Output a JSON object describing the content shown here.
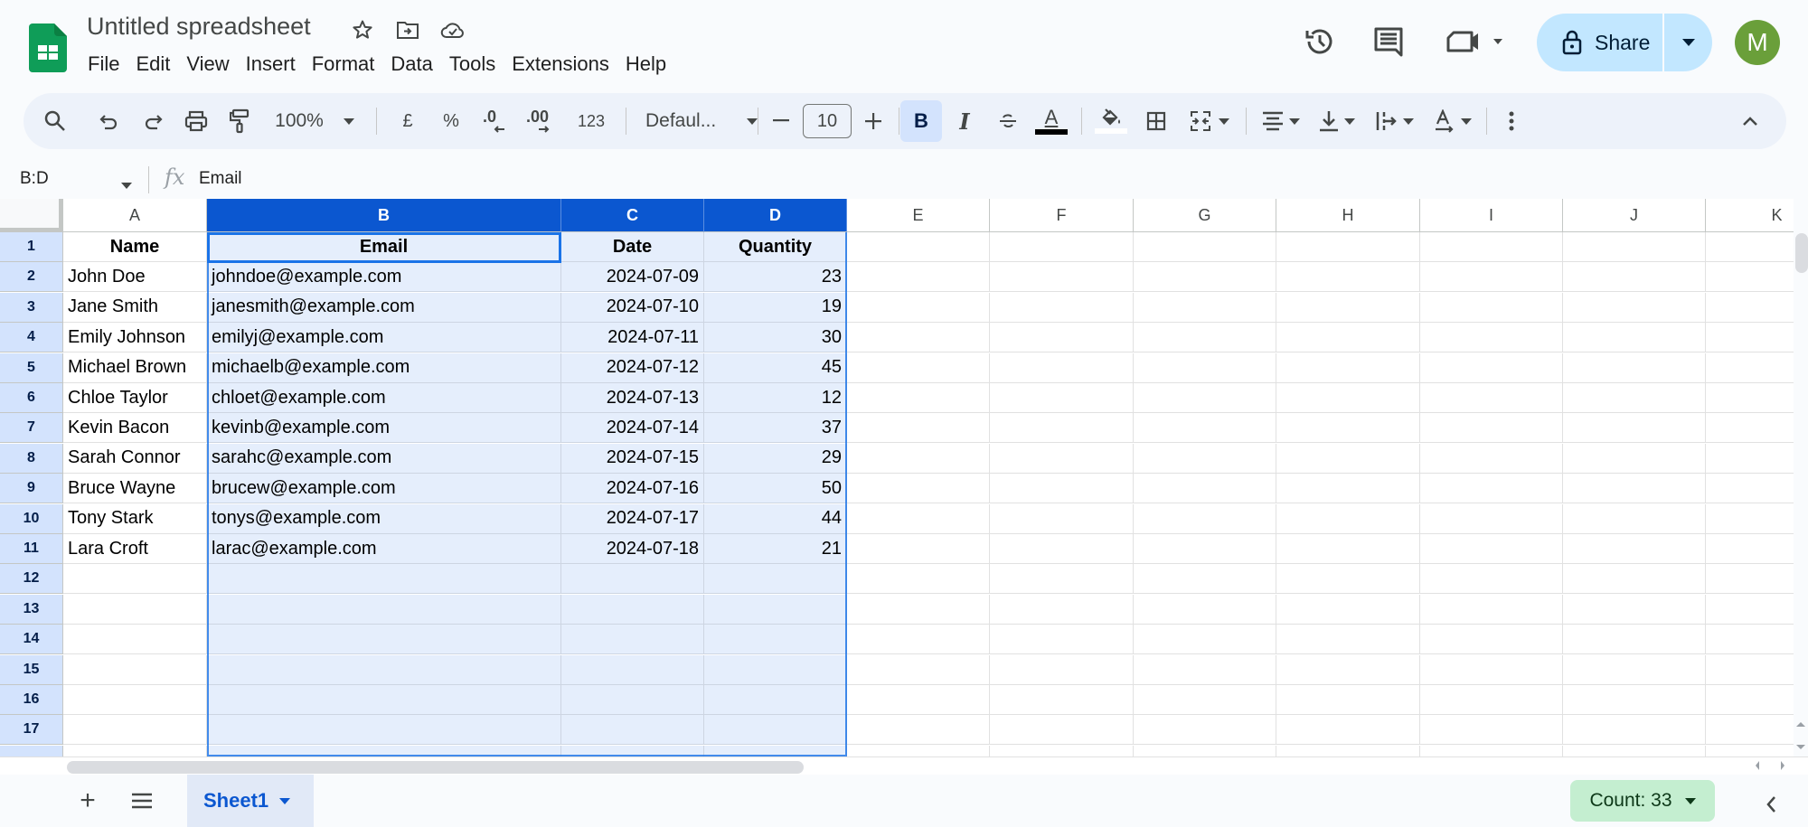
{
  "app": {
    "title": "Untitled spreadsheet",
    "avatar_initial": "M",
    "share_label": "Share",
    "brand_color": "#0f9d58",
    "accent_color": "#0b57d0"
  },
  "menu": [
    "File",
    "Edit",
    "View",
    "Insert",
    "Format",
    "Data",
    "Tools",
    "Extensions",
    "Help"
  ],
  "toolbar": {
    "zoom": "100%",
    "currency": "£",
    "percent": "%",
    "decrease_decimal": ".0",
    "increase_decimal": ".00",
    "format_123": "123",
    "font": "Defaul...",
    "font_size": "10",
    "bold": "B",
    "italic": "I",
    "text_color": "A"
  },
  "formula_bar": {
    "name_box": "B:D",
    "fx": "fx",
    "content": "Email"
  },
  "grid": {
    "columns": [
      "A",
      "B",
      "C",
      "D",
      "E",
      "F",
      "G",
      "H",
      "I",
      "J",
      "K"
    ],
    "selected_columns": [
      "B",
      "C",
      "D"
    ],
    "row_numbers": [
      "1",
      "2",
      "3",
      "4",
      "5",
      "6",
      "7",
      "8",
      "9",
      "10",
      "11",
      "12",
      "13",
      "14",
      "15",
      "16",
      "17"
    ],
    "header_row": [
      "Name",
      "Email",
      "Date",
      "Quantity"
    ],
    "rows": [
      [
        "John Doe",
        "johndoe@example.com",
        "2024-07-09",
        "23"
      ],
      [
        "Jane Smith",
        "janesmith@example.com",
        "2024-07-10",
        "19"
      ],
      [
        "Emily Johnson",
        "emilyj@example.com",
        "2024-07-11",
        "30"
      ],
      [
        "Michael Brown",
        "michaelb@example.com",
        "2024-07-12",
        "45"
      ],
      [
        "Chloe Taylor",
        "chloet@example.com",
        "2024-07-13",
        "12"
      ],
      [
        "Kevin Bacon",
        "kevinb@example.com",
        "2024-07-14",
        "37"
      ],
      [
        "Sarah Connor",
        "sarahc@example.com",
        "2024-07-15",
        "29"
      ],
      [
        "Bruce Wayne",
        "brucew@example.com",
        "2024-07-16",
        "50"
      ],
      [
        "Tony Stark",
        "tonys@example.com",
        "2024-07-17",
        "44"
      ],
      [
        "Lara Croft",
        "larac@example.com",
        "2024-07-18",
        "21"
      ]
    ]
  },
  "bottom": {
    "sheet_tab": "Sheet1",
    "add_sheet": "+",
    "count": "Count: 33"
  }
}
